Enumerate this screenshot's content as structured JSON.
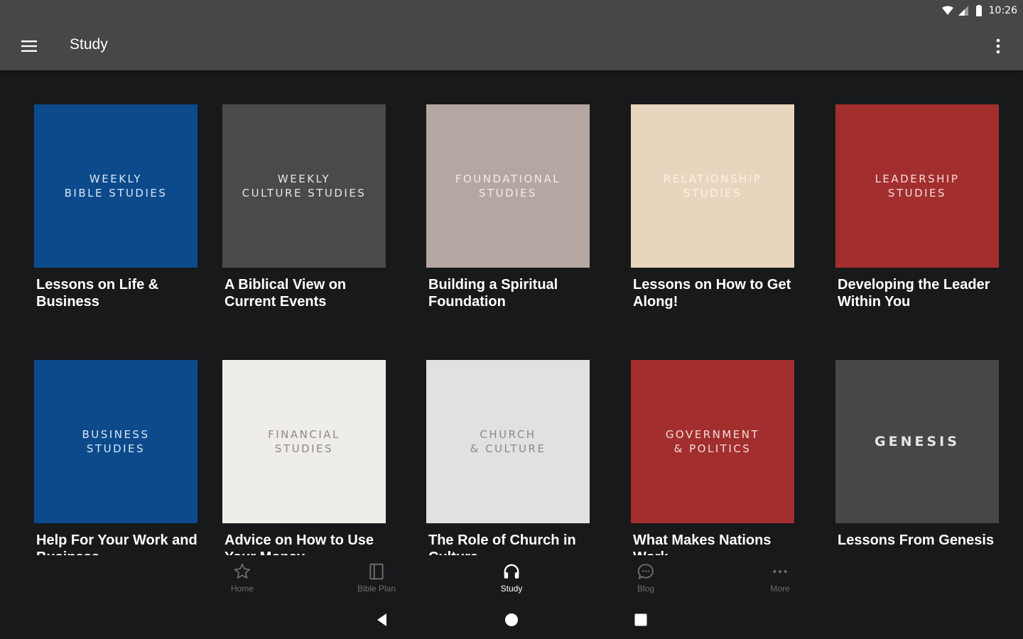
{
  "status_bar": {
    "time": "10:26",
    "icons": [
      "wifi-icon",
      "signal-icon",
      "battery-icon"
    ]
  },
  "app_bar": {
    "title": "Study",
    "menu_icon": "hamburger-menu-icon",
    "overflow_icon": "more-vertical-icon"
  },
  "studies": [
    {
      "cover_text": "WEEKLY\nBIBLE STUDIES",
      "title": "Lessons on Life & Business",
      "bg": "#0c4a8c",
      "fg": "#dbe7f4"
    },
    {
      "cover_text": "WEEKLY\nCULTURE STUDIES",
      "title": "A Biblical View on Current Events",
      "bg": "#4a4a4a",
      "fg": "#e6e6e6"
    },
    {
      "cover_text": "FOUNDATIONAL\nSTUDIES",
      "title": "Building a Spiritual Foundation",
      "bg": "#b4a6a1",
      "fg": "#f3ecea"
    },
    {
      "cover_text": "RELATIONSHIP\nSTUDIES",
      "title": "Lessons on How to Get Along!",
      "bg": "#e9d5bd",
      "fg": "#f9f1e7"
    },
    {
      "cover_text": "LEADERSHIP\nSTUDIES",
      "title": "Developing the Leader Within You",
      "bg": "#a32e2e",
      "fg": "#f4dcdc"
    },
    {
      "cover_text": "BUSINESS\nSTUDIES",
      "title": "Help For Your Work and Business",
      "bg": "#0c4a8c",
      "fg": "#dbe7f4"
    },
    {
      "cover_text": "FINANCIAL\nSTUDIES",
      "title": "Advice on How to Use Your Money",
      "bg": "#efede7",
      "fg": "#8e8b86"
    },
    {
      "cover_text": "CHURCH\n& CULTURE",
      "title": "The Role of Church in Culture",
      "bg": "#e1e1e1",
      "fg": "#8a8a8a"
    },
    {
      "cover_text": "GOVERNMENT\n& POLITICS",
      "title": "What Makes Nations Work",
      "bg": "#a32e2e",
      "fg": "#f4dcdc"
    },
    {
      "cover_text": "GENESIS",
      "title": "Lessons From Genesis",
      "bg": "#474747",
      "fg": "#e6e6e6",
      "big": true
    }
  ],
  "bottom_nav": [
    {
      "label": "Home",
      "icon": "star-icon",
      "active": false
    },
    {
      "label": "Bible Plan",
      "icon": "book-icon",
      "active": false
    },
    {
      "label": "Study",
      "icon": "headphones-icon",
      "active": true
    },
    {
      "label": "Blog",
      "icon": "chat-bubble-icon",
      "active": false
    },
    {
      "label": "More",
      "icon": "more-horizontal-icon",
      "active": false
    }
  ],
  "system_nav": [
    "back-icon",
    "home-icon",
    "recents-icon"
  ]
}
